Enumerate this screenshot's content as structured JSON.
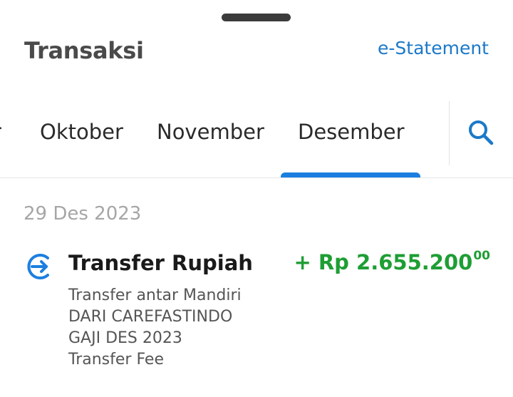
{
  "header": {
    "title": "Transaksi",
    "estatement_label": "e-Statement"
  },
  "tabs": {
    "items": [
      {
        "label": "r",
        "selected": false
      },
      {
        "label": "Oktober",
        "selected": false
      },
      {
        "label": "November",
        "selected": false
      },
      {
        "label": "Desember",
        "selected": true
      }
    ]
  },
  "icons": {
    "search": "search-icon",
    "transfer": "transfer-arrow-icon"
  },
  "colors": {
    "accent": "#1c7fe0",
    "link": "#1b79c9",
    "amount_positive": "#1e9e34"
  },
  "transactions": {
    "date": "29 Des 2023",
    "items": [
      {
        "title": "Transfer Rupiah",
        "amount": "+ Rp 2.655.200",
        "amount_cents": "00",
        "lines": [
          "Transfer antar Mandiri",
          "DARI CAREFASTINDO",
          "GAJI DES 2023",
          "Transfer Fee"
        ]
      }
    ]
  }
}
